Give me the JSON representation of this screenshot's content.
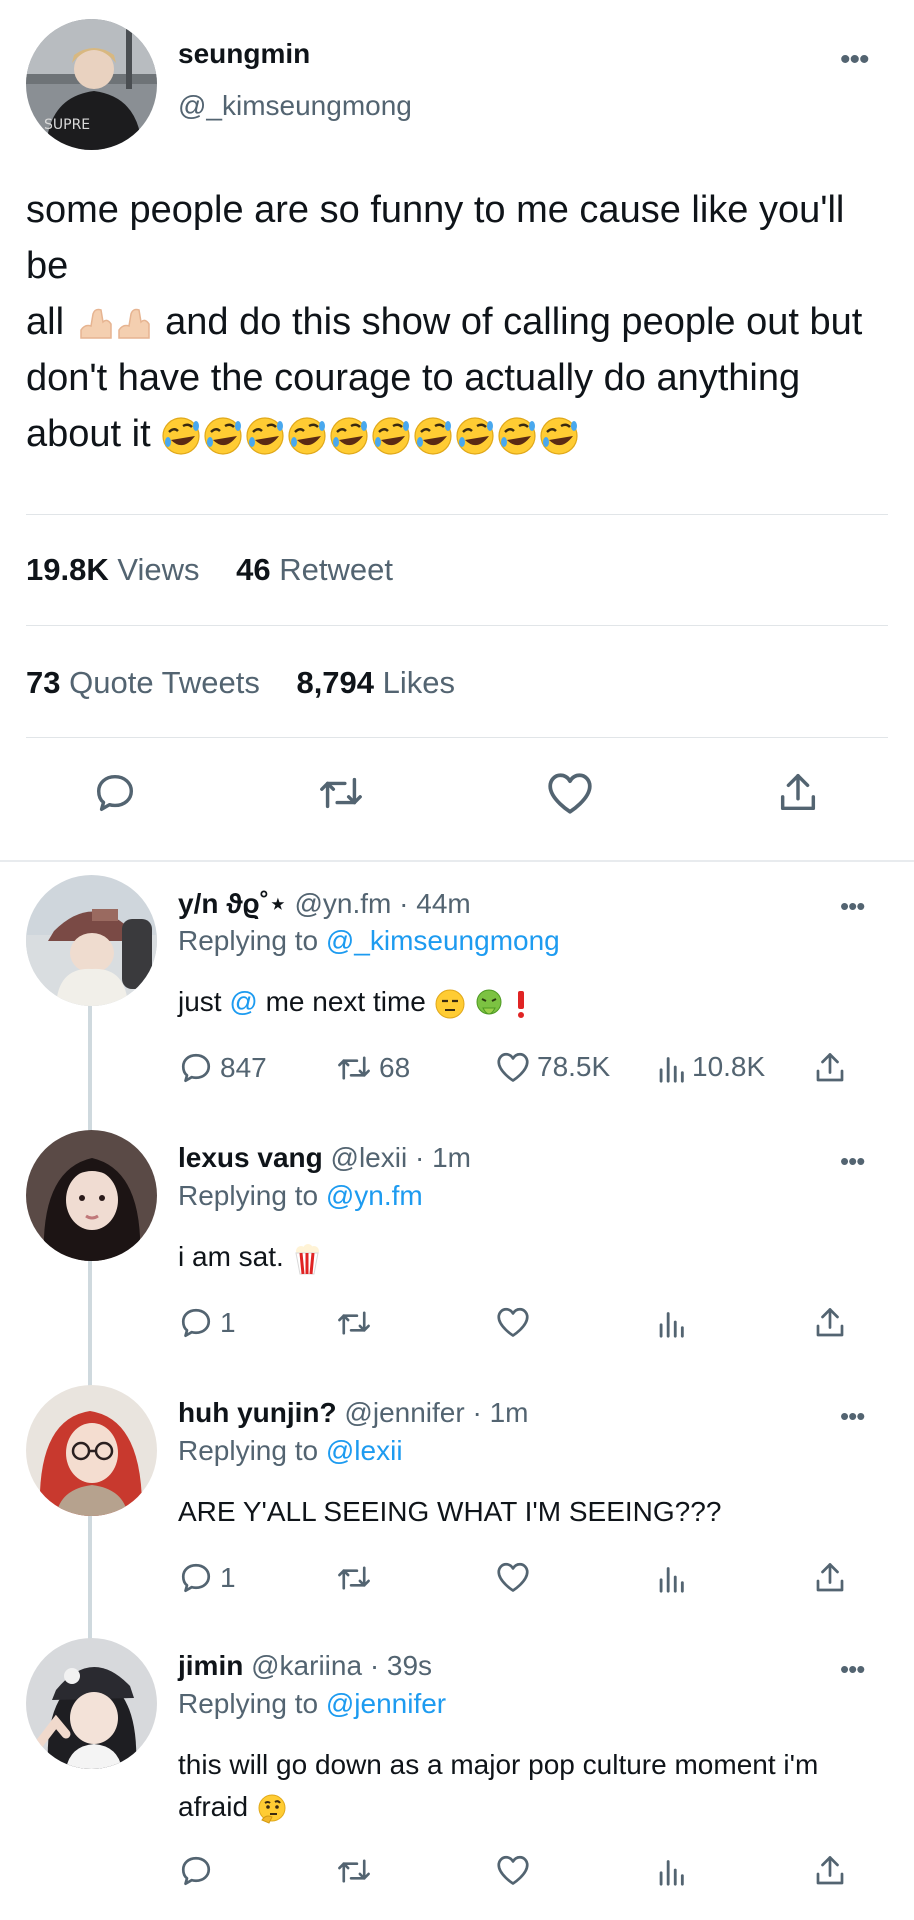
{
  "main_tweet": {
    "name": "seungmin",
    "handle": "@_kimseungmong",
    "avatar_caption": "SUPRE",
    "text_line1": "some people are so funny to me cause like you'll be",
    "text_line2a": "all",
    "text_line2b": "and do this show of calling people out but",
    "text_line3": "don't have the courage to actually do anything",
    "text_line4": "about it",
    "views_count": "19.8K",
    "views_label": "Views",
    "retweet_count": "46",
    "retweet_label": "Retweet",
    "quote_count": "73",
    "quote_label": "Quote Tweets",
    "likes_count": "8,794",
    "likes_label": "Likes"
  },
  "replies": [
    {
      "name": "y/n ϑϱ˚⋆",
      "handle": "@yn.fm",
      "time": "· 44m",
      "replying_prefix": "Replying to",
      "replying_to": "@_kimseungmong",
      "text_a": "just",
      "text_mention": "@",
      "text_b": "me next time",
      "reply_count": "847",
      "retweet_count": "68",
      "like_count": "78.5K",
      "view_count": "10.8K"
    },
    {
      "name": "lexus vang",
      "handle": "@lexii",
      "time": "· 1m",
      "replying_prefix": "Replying to",
      "replying_to": "@yn.fm",
      "text": "i am sat.",
      "reply_count": "1"
    },
    {
      "name": "huh yunjin?",
      "handle": "@jennifer",
      "time": "· 1m",
      "replying_prefix": "Replying to",
      "replying_to": "@lexii",
      "text": "ARE Y'ALL SEEING WHAT I'M SEEING???",
      "reply_count": "1"
    },
    {
      "name": "jimin",
      "handle": "@kariina",
      "time": "· 39s",
      "replying_prefix": "Replying to",
      "replying_to": "@jennifer",
      "text_line1": "this will go down as a major pop culture moment i'm",
      "text_line2": "afraid"
    }
  ],
  "icons": {
    "reply": "speech-bubble-icon",
    "retweet": "retweet-icon",
    "like": "heart-icon",
    "share": "share-icon",
    "views": "bar-chart-icon",
    "more": "more-dots-icon"
  },
  "colors": {
    "text": "#0f1419",
    "secondary": "#536471",
    "mention": "#1d9bf0",
    "divider": "#e1e5e8",
    "thread_line": "#cfd9de",
    "emoji_yellow": "#ffcc33"
  }
}
